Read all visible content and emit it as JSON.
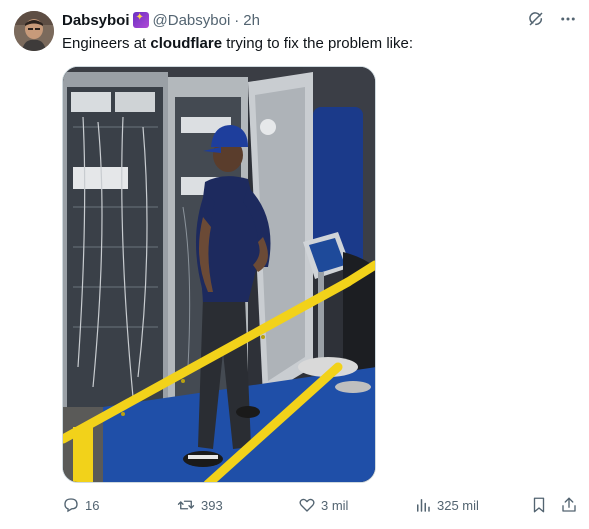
{
  "tweet": {
    "author": {
      "name": "Dabsyboi",
      "handle": "@Dabsyboi",
      "separator": "·",
      "time": "2h",
      "badge_icon": "sparkles-emoji-icon"
    },
    "text": {
      "before": "Engineers at ",
      "bold": "cloudflare",
      "after": " trying to fix the problem like:"
    },
    "header_icons": [
      "grok-icon",
      "more-options-icon"
    ],
    "actions": {
      "replies": "16",
      "reposts": "393",
      "likes": "3 mil",
      "views": "325 mil"
    }
  },
  "colors": {
    "text_primary": "#0f1419",
    "text_secondary": "#536471",
    "border": "#cfd9de",
    "railing_yellow": "#f2d21a",
    "floor_blue": "#1f4fa8"
  }
}
